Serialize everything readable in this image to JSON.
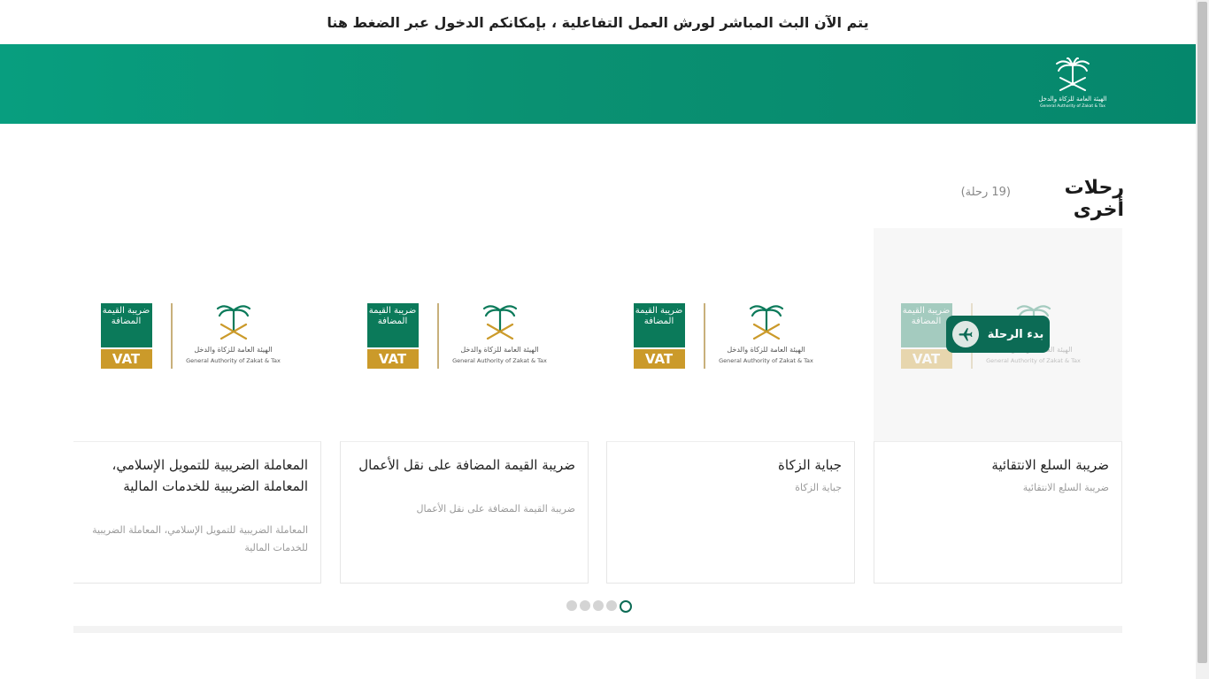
{
  "announcement": "يتم الآن البث المباشر لورش العمل التفاعلية ، بإمكانكم الدخول عبر الضغط هنا",
  "header": {
    "logo_ar": "الهيئة العامة للزكاة والدخل",
    "logo_en": "General Authority of Zakat & Tax",
    "bg_color": "#089e7f"
  },
  "section": {
    "title": "رحلات أخرى",
    "count": "(19 رحلة)"
  },
  "vat_logo": {
    "ar_word": "ضريبة القيمة المضافة",
    "vat": "VAT",
    "authority_ar": "الهيئة العامة للزكاة والدخل",
    "authority_en": "General Authority of Zakat & Tax"
  },
  "cards": [
    {
      "title": "ضريبة السلع الانتقائية",
      "desc": "ضريبة السلع الانتقائية",
      "button": "بدء الرحلة"
    },
    {
      "title": "جباية الزكاة",
      "desc": "جباية الزكاة"
    },
    {
      "title": "ضريبة القيمة المضافة على نقل الأعمال",
      "desc": "ضريبة القيمة المضافة على نقل الأعمال"
    },
    {
      "title": "المعاملة الضريبية للتمويل الإسلامي، المعاملة الضريبية للخدمات المالية",
      "desc": "المعاملة الضريبية للتمويل الإسلامي، المعاملة الضريبية للخدمات المالية"
    }
  ],
  "pagination": {
    "total": 5,
    "active": 5
  },
  "colors": {
    "accent": "#0c6b55",
    "gold": "#cb9a2a"
  }
}
